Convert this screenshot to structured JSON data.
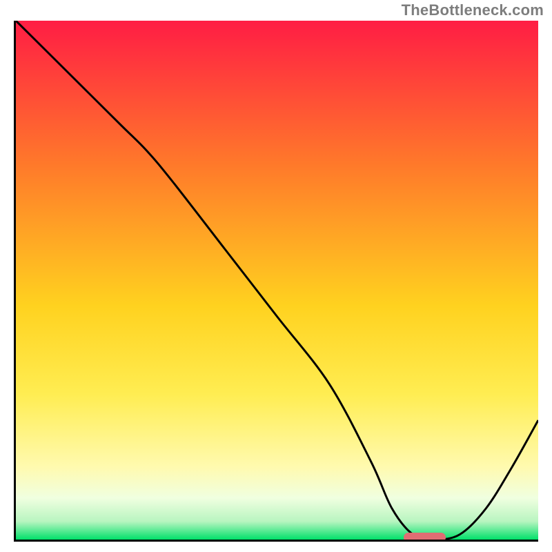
{
  "watermark": "TheBottleneck.com",
  "colors": {
    "gradient_top": "#ff1d44",
    "gradient_mid_upper": "#ff7a2a",
    "gradient_mid": "#ffd21f",
    "gradient_mid_lower": "#ffed52",
    "gradient_pale": "#fffaaf",
    "gradient_band_top": "#f0ffe0",
    "gradient_green": "#00e06a",
    "curve": "#000000",
    "marker": "#e06d73",
    "axis": "#000000"
  },
  "chart_data": {
    "type": "line",
    "title": "",
    "xlabel": "",
    "ylabel": "",
    "xlim": [
      0,
      100
    ],
    "ylim": [
      0,
      100
    ],
    "series": [
      {
        "name": "bottleneck-curve",
        "x": [
          0,
          10,
          20,
          25,
          30,
          40,
          50,
          60,
          68,
          72,
          76,
          80,
          85,
          90,
          95,
          100
        ],
        "y": [
          100,
          90,
          80,
          75,
          69,
          56,
          43,
          30,
          15,
          6,
          1,
          0,
          1,
          6,
          14,
          23
        ]
      }
    ],
    "annotations": [
      {
        "kind": "optimal-marker",
        "x_start": 74,
        "x_end": 82,
        "y": 0.8
      }
    ],
    "background": {
      "kind": "vertical-gradient",
      "stops": [
        {
          "pos": 0.0,
          "color": "#ff1d44"
        },
        {
          "pos": 0.28,
          "color": "#ff7a2a"
        },
        {
          "pos": 0.55,
          "color": "#ffd21f"
        },
        {
          "pos": 0.72,
          "color": "#ffed52"
        },
        {
          "pos": 0.86,
          "color": "#fffaaf"
        },
        {
          "pos": 0.92,
          "color": "#f0ffe0"
        },
        {
          "pos": 0.965,
          "color": "#b8f5c0"
        },
        {
          "pos": 1.0,
          "color": "#00e06a"
        }
      ]
    }
  }
}
